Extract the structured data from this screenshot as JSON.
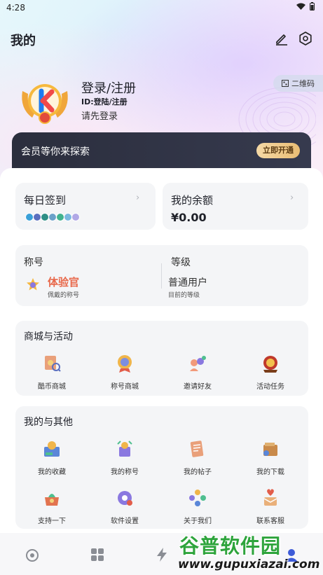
{
  "status_bar": {
    "time": "4:28"
  },
  "header": {
    "title": "我的"
  },
  "user": {
    "name": "登录/注册",
    "id_text": "ID:登陆/注册",
    "hint": "请先登录",
    "qr_label": "二维码"
  },
  "vip": {
    "text": "会员等你来探索",
    "button": "立即开通"
  },
  "checkin": {
    "title": "每日签到"
  },
  "balance": {
    "title": "我的余额",
    "amount": "¥0.00"
  },
  "rank": {
    "title_label": "称号",
    "title_value": "体验官",
    "title_sub": "佩戴的称号",
    "level_label": "等级",
    "level_value": "普通用户",
    "level_sub": "目前的等级"
  },
  "mall": {
    "heading": "商城与活动",
    "items": [
      {
        "label": "酷币商城",
        "icon": "coin-mall-icon"
      },
      {
        "label": "称号商城",
        "icon": "title-mall-icon"
      },
      {
        "label": "邀请好友",
        "icon": "invite-friends-icon"
      },
      {
        "label": "活动任务",
        "icon": "activity-task-icon"
      }
    ]
  },
  "mine": {
    "heading": "我的与其他",
    "items": [
      {
        "label": "我的收藏",
        "icon": "favorites-icon"
      },
      {
        "label": "我的称号",
        "icon": "my-titles-icon"
      },
      {
        "label": "我的帖子",
        "icon": "my-posts-icon"
      },
      {
        "label": "我的下载",
        "icon": "downloads-icon"
      },
      {
        "label": "支持一下",
        "icon": "support-icon"
      },
      {
        "label": "软件设置",
        "icon": "settings-icon"
      },
      {
        "label": "关于我们",
        "icon": "about-icon"
      },
      {
        "label": "联系客服",
        "icon": "customer-service-icon"
      }
    ]
  },
  "watermark": {
    "name": "谷普软件园",
    "url": "www.gupuxiazai.com"
  },
  "colors": {
    "vip_bg": "#2b2e3d",
    "vip_button": "#e9bd74",
    "title_red": "#e8684a"
  }
}
